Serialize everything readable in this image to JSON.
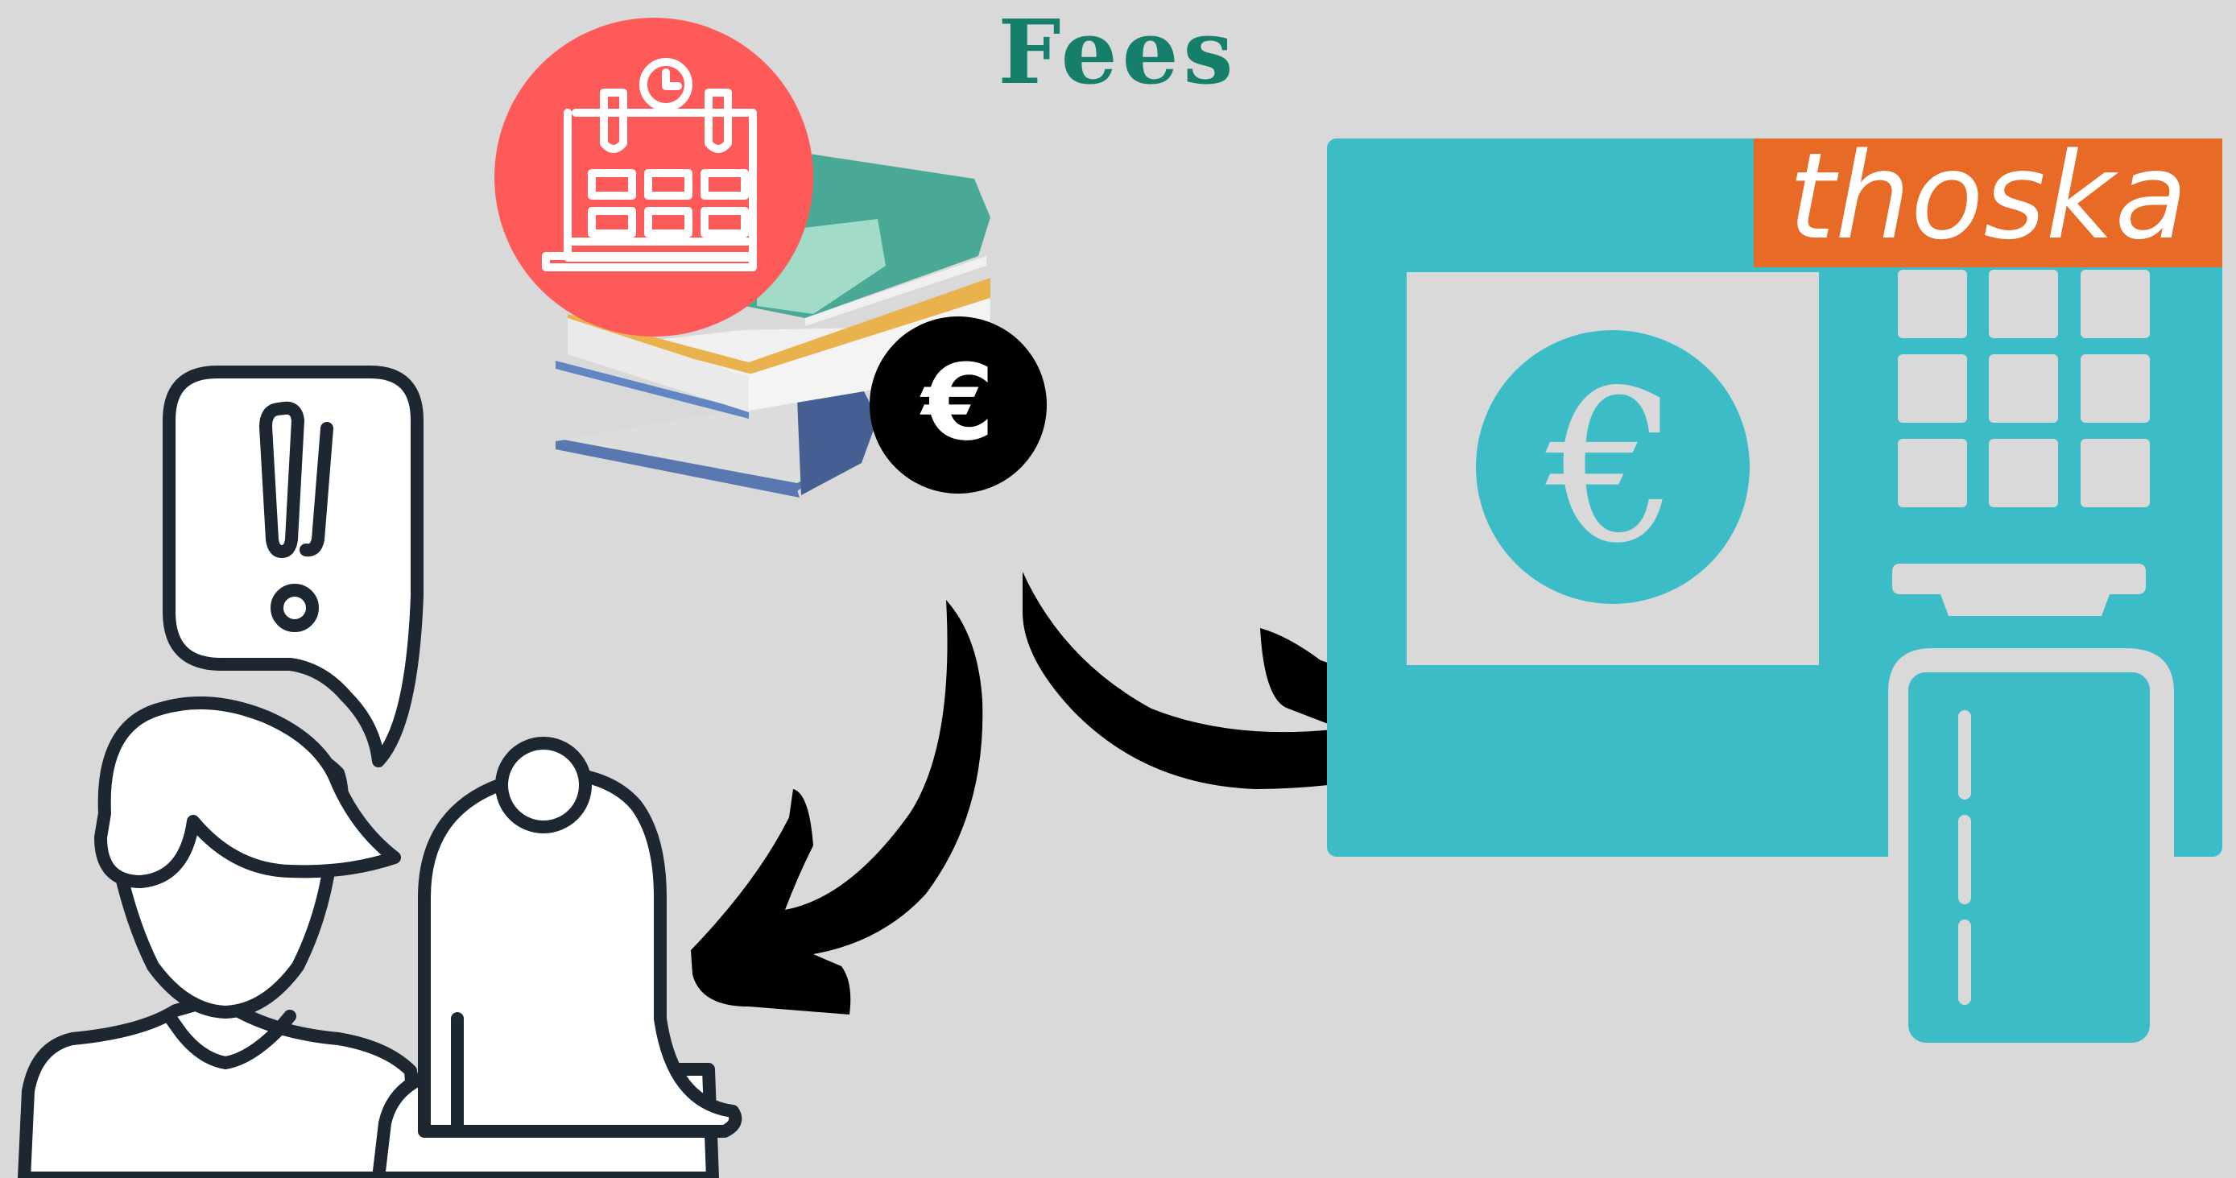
{
  "title": "Fees",
  "brand": {
    "name": "thoska",
    "color": "#e76a26",
    "text_color": "#ffffff"
  },
  "euro_symbol": "€",
  "colors": {
    "background": "#d9d9d9",
    "title": "#157f6c",
    "terminal": "#3bbcc6",
    "calendar_badge": "#fe5a59",
    "euro_coin": "#000000",
    "arrow": "#000000",
    "outline": "#1c2731"
  },
  "icons": [
    "calendar-clock-icon",
    "books-stack-icon",
    "euro-coin-icon",
    "parents-icon",
    "alert-speech-bubble-icon",
    "notification-bell-icon",
    "payment-terminal-icon",
    "arrow-icon"
  ]
}
